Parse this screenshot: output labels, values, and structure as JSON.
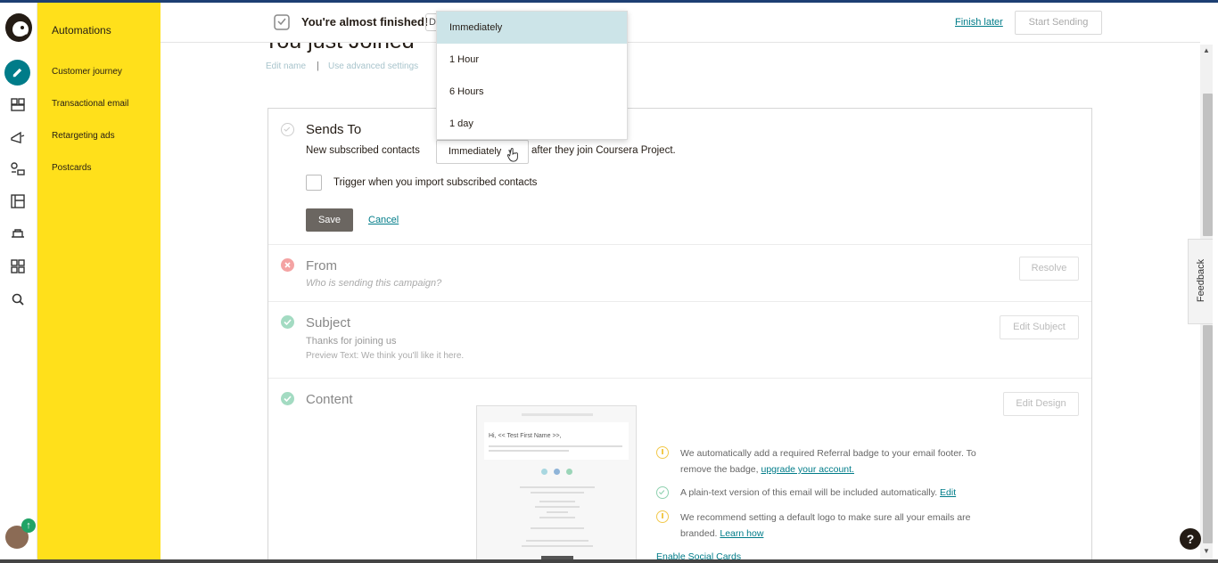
{
  "sidebar": {
    "title": "Automations",
    "links": [
      "Customer journey",
      "Transactional email",
      "Retargeting ads",
      "Postcards"
    ],
    "rail_icons": [
      "pencil-icon",
      "campaigns-icon",
      "megaphone-icon",
      "audience-icon",
      "templates-icon",
      "integrations-icon",
      "grid-icon",
      "search-icon"
    ]
  },
  "header": {
    "status_text": "You're almost finished!",
    "d_badge": "D",
    "finish_later": "Finish later",
    "start_sending": "Start Sending"
  },
  "page": {
    "title": "You just Joined",
    "edit_name": "Edit name",
    "separator": "|",
    "advanced": "Use advanced settings"
  },
  "sends_to": {
    "title": "Sends To",
    "prefix": "New subscribed contacts",
    "select_value": "Immediately",
    "suffix": "after they join Coursera Project.",
    "trigger_label": "Trigger when you import subscribed contacts",
    "save": "Save",
    "cancel": "Cancel"
  },
  "dropdown": {
    "options": [
      "Immediately",
      "1 Hour",
      "6 Hours",
      "1 day"
    ],
    "selected": "Immediately"
  },
  "from": {
    "title": "From",
    "sub": "Who is sending this campaign?",
    "button": "Resolve"
  },
  "subject": {
    "title": "Subject",
    "line": "Thanks for joining us",
    "preview": "Preview Text: We think you'll like it here.",
    "button": "Edit Subject"
  },
  "content": {
    "title": "Content",
    "button": "Edit Design",
    "preview_greeting": "Hi, << Test First Name >>,",
    "notes": [
      {
        "text": "We automatically add a required Referral badge to your email footer. To remove the badge, ",
        "link": "upgrade your account.",
        "status": "warning"
      },
      {
        "text": "A plain-text version of this email will be included automatically. ",
        "link": "Edit",
        "status": "ok"
      },
      {
        "text": "We recommend setting a default logo to make sure all your emails are branded. ",
        "link": "Learn how",
        "status": "warning"
      }
    ],
    "social": "Enable Social Cards"
  },
  "feedback": "Feedback",
  "help": "?",
  "avatar_badge": "↑",
  "colors": {
    "yellow": "#ffe01b",
    "teal": "#007c89",
    "green": "#8fd1b0",
    "red": "#f29b9b",
    "warning": "#f2c94c"
  }
}
